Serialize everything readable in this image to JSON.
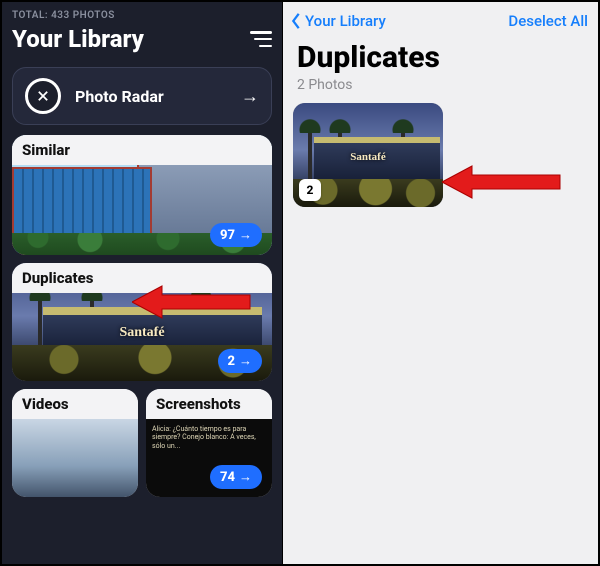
{
  "left": {
    "total_label": "TOTAL: 433 PHOTOS",
    "title": "Your Library",
    "radar": {
      "label": "Photo Radar",
      "arrow": "→"
    },
    "cards": {
      "similar": {
        "label": "Similar",
        "count": "97",
        "arrow": "→"
      },
      "duplicates": {
        "label": "Duplicates",
        "count": "2",
        "arrow": "→",
        "sign": "Santafé"
      },
      "videos": {
        "label": "Videos"
      },
      "screenshots": {
        "label": "Screenshots",
        "count": "74",
        "arrow": "→",
        "body_text": "Alicia: ¿Cuánto tiempo es para siempre?\nConejo blanco: A veces, sólo un..."
      }
    }
  },
  "right": {
    "back_label": "Your Library",
    "deselect_label": "Deselect All",
    "title": "Duplicates",
    "subtitle": "2 Photos",
    "thumb_badge": "2",
    "thumb_sign": "Santafé"
  }
}
